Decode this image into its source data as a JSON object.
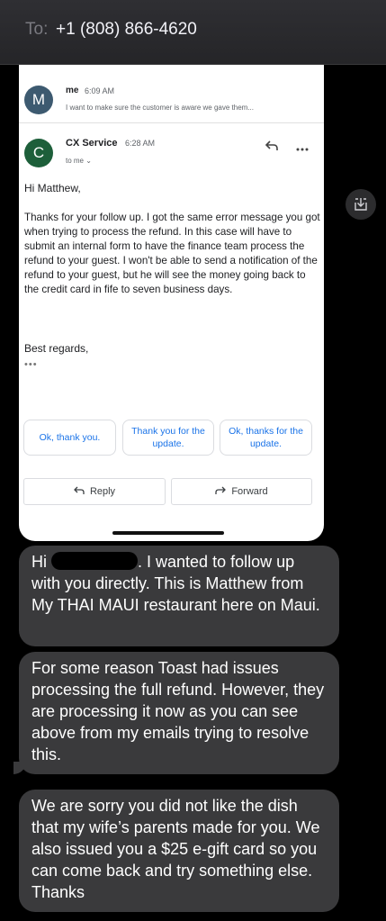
{
  "header": {
    "to_label": "To:",
    "recipient": "+1 (808) 866-4620"
  },
  "email": {
    "previous": {
      "avatar": "M",
      "sender": "me",
      "time": "6:09 AM",
      "snippet": "I want to make sure the customer is aware we gave them..."
    },
    "current": {
      "avatar": "C",
      "sender": "CX Service",
      "time": "6:28 AM",
      "to": "to me ⌄",
      "greeting": "Hi Matthew,",
      "body": "Thanks for your follow up. I got the same error message you got when trying to process the refund. In this case will have to submit an internal form to have the finance team  process the refund to your guest. I won't be able to send a notification of the refund to your guest, but he will see the money going back to the credit card in fife to seven business days.",
      "regards": "Best regards,",
      "ellipsis": "•••"
    },
    "smart_replies": [
      "Ok, thank you.",
      "Thank you for the update.",
      "Ok, thanks for the update."
    ],
    "actions": {
      "reply": "Reply",
      "forward": "Forward"
    },
    "icons": {
      "reply": "reply-arrow-icon",
      "more": "more-vert-icon",
      "download": "download-icon"
    }
  },
  "messages": {
    "m1_pre": "Hi",
    "m1_post": ". I wanted to follow up with you directly. This is Matthew from My THAI MAUI restaurant here on Maui.",
    "m2": "For some reason Toast had issues processing the full refund. However, they are processing it now as you can see above from my emails trying to resolve this.",
    "m3": "We are sorry you did not like the dish that my wife’s parents made for you. We also issued you a $25 e-gift card so you can come back and try something else. Thanks"
  }
}
